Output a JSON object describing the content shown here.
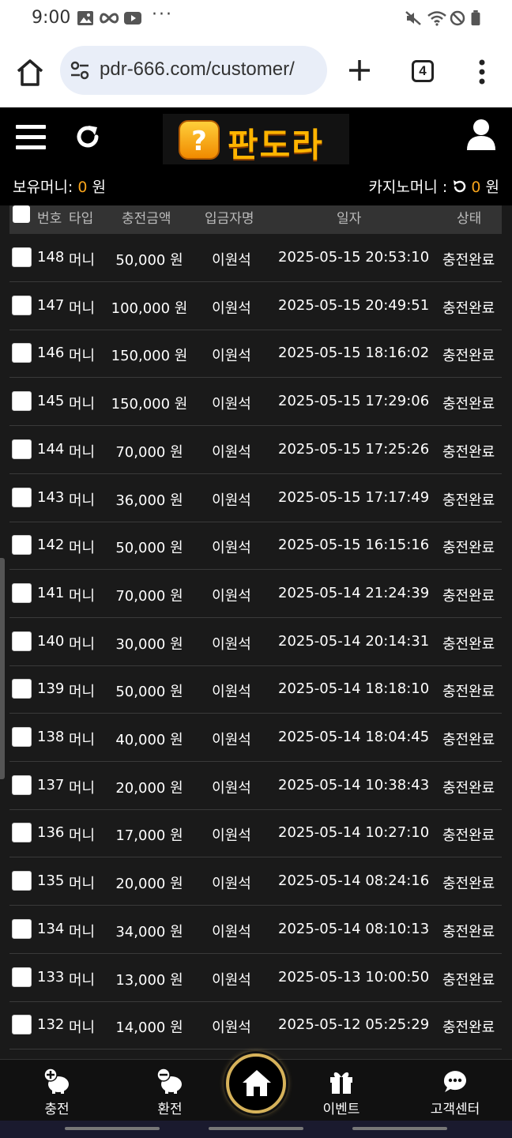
{
  "status_bar": {
    "time": "9:00",
    "more": "···",
    "icons": [
      "image-icon",
      "link-icon",
      "youtube-icon",
      "mute-icon",
      "wifi-icon",
      "dnd-icon",
      "battery-icon"
    ]
  },
  "browser": {
    "url": "pdr-666.com/customer/",
    "tab_count": "4"
  },
  "header": {
    "logo_text": "판도라",
    "logo_mark": "?",
    "holding_money_label": "보유머니: ",
    "holding_money_value": "0",
    "holding_money_unit": " 원",
    "casino_money_label": "카지노머니 : ",
    "casino_money_value": "0",
    "casino_money_unit": " 원"
  },
  "table": {
    "headers": [
      "번호",
      "타입",
      "충전금액",
      "입금자명",
      "일자",
      "상태"
    ],
    "rows": [
      {
        "id": "148",
        "type": "머니",
        "amount": "50,000 원",
        "name": "이원석",
        "date": "2025-05-15 20:53:10",
        "status": "충전완료"
      },
      {
        "id": "147",
        "type": "머니",
        "amount": "100,000 원",
        "name": "이원석",
        "date": "2025-05-15 20:49:51",
        "status": "충전완료"
      },
      {
        "id": "146",
        "type": "머니",
        "amount": "150,000 원",
        "name": "이원석",
        "date": "2025-05-15 18:16:02",
        "status": "충전완료"
      },
      {
        "id": "145",
        "type": "머니",
        "amount": "150,000 원",
        "name": "이원석",
        "date": "2025-05-15 17:29:06",
        "status": "충전완료"
      },
      {
        "id": "144",
        "type": "머니",
        "amount": "70,000 원",
        "name": "이원석",
        "date": "2025-05-15 17:25:26",
        "status": "충전완료"
      },
      {
        "id": "143",
        "type": "머니",
        "amount": "36,000 원",
        "name": "이원석",
        "date": "2025-05-15 17:17:49",
        "status": "충전완료"
      },
      {
        "id": "142",
        "type": "머니",
        "amount": "50,000 원",
        "name": "이원석",
        "date": "2025-05-15 16:15:16",
        "status": "충전완료"
      },
      {
        "id": "141",
        "type": "머니",
        "amount": "70,000 원",
        "name": "이원석",
        "date": "2025-05-14 21:24:39",
        "status": "충전완료"
      },
      {
        "id": "140",
        "type": "머니",
        "amount": "30,000 원",
        "name": "이원석",
        "date": "2025-05-14 20:14:31",
        "status": "충전완료"
      },
      {
        "id": "139",
        "type": "머니",
        "amount": "50,000 원",
        "name": "이원석",
        "date": "2025-05-14 18:18:10",
        "status": "충전완료"
      },
      {
        "id": "138",
        "type": "머니",
        "amount": "40,000 원",
        "name": "이원석",
        "date": "2025-05-14 18:04:45",
        "status": "충전완료"
      },
      {
        "id": "137",
        "type": "머니",
        "amount": "20,000 원",
        "name": "이원석",
        "date": "2025-05-14 10:38:43",
        "status": "충전완료"
      },
      {
        "id": "136",
        "type": "머니",
        "amount": "17,000 원",
        "name": "이원석",
        "date": "2025-05-14 10:27:10",
        "status": "충전완료"
      },
      {
        "id": "135",
        "type": "머니",
        "amount": "20,000 원",
        "name": "이원석",
        "date": "2025-05-14 08:24:16",
        "status": "충전완료"
      },
      {
        "id": "134",
        "type": "머니",
        "amount": "34,000 원",
        "name": "이원석",
        "date": "2025-05-14 08:10:13",
        "status": "충전완료"
      },
      {
        "id": "133",
        "type": "머니",
        "amount": "13,000 원",
        "name": "이원석",
        "date": "2025-05-13 10:00:50",
        "status": "충전완료"
      },
      {
        "id": "132",
        "type": "머니",
        "amount": "14,000 원",
        "name": "이원석",
        "date": "2025-05-12 05:25:29",
        "status": "충전완료"
      }
    ]
  },
  "bottom_nav": {
    "deposit": "충전",
    "withdraw": "환전",
    "home": "home",
    "event": "이벤트",
    "support": "고객센터"
  },
  "colors": {
    "accent": "#f6a31b",
    "logo_gold": "#ffb400",
    "home_ring": "#d6b25a"
  }
}
